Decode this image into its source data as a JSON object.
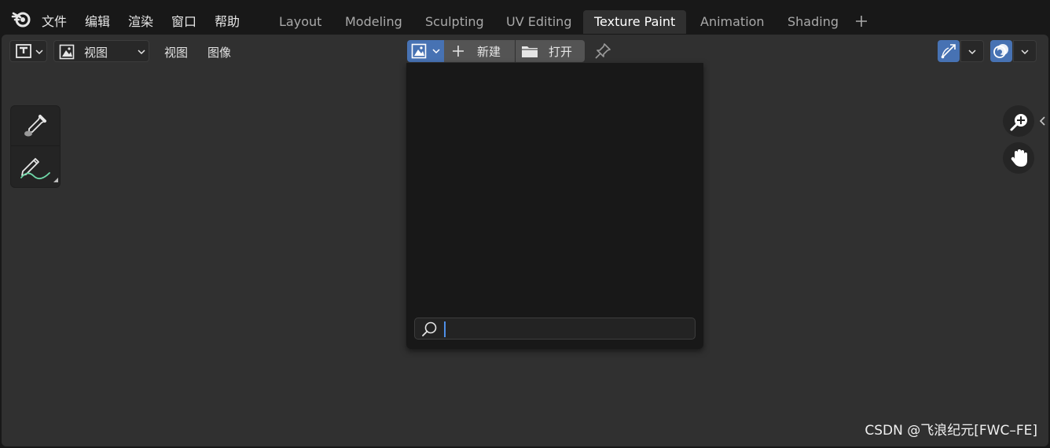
{
  "app": {
    "logo_icon": "blender-logo-icon"
  },
  "menu": {
    "items": [
      {
        "label": "文件"
      },
      {
        "label": "编辑"
      },
      {
        "label": "渲染"
      },
      {
        "label": "窗口"
      },
      {
        "label": "帮助"
      }
    ]
  },
  "workspaces": {
    "tabs": [
      {
        "label": "Layout"
      },
      {
        "label": "Modeling"
      },
      {
        "label": "Sculpting"
      },
      {
        "label": "UV Editing"
      },
      {
        "label": "Texture Paint",
        "active": true
      },
      {
        "label": "Animation"
      },
      {
        "label": "Shading"
      }
    ],
    "add_icon": "plus-icon"
  },
  "header": {
    "editor_type_icon": "image-editor-icon",
    "mode_selector": {
      "icon": "image-icon",
      "value": "视图"
    },
    "menus": [
      {
        "label": "视图"
      },
      {
        "label": "图像"
      }
    ],
    "image_browse_icon": "image-browse-icon",
    "new_label": "新建",
    "open_label": "打开",
    "pin_icon": "pin-icon",
    "gizmo_icon": "gizmo-icon",
    "overlay_icon": "overlay-icon"
  },
  "toolbar": {
    "tools": [
      {
        "name": "sample",
        "icon": "eyedropper-icon"
      },
      {
        "name": "annotate",
        "icon": "annotate-pencil-icon"
      }
    ]
  },
  "popup": {
    "search": {
      "icon": "search-icon",
      "value": "",
      "placeholder": ""
    }
  },
  "navigation": {
    "zoom_icon": "zoom-icon",
    "pan_icon": "hand-pan-icon",
    "sidebar_toggle_icon": "chevron-left-icon"
  },
  "watermark": {
    "text": "CSDN @飞浪纪元[FWC–FE]"
  },
  "colors": {
    "accent": "#4772b3",
    "background": "#303030",
    "topbar": "#181818",
    "active_tab": "#303030",
    "popup": "#181818",
    "annotate_stroke": "#6fd8a8"
  }
}
